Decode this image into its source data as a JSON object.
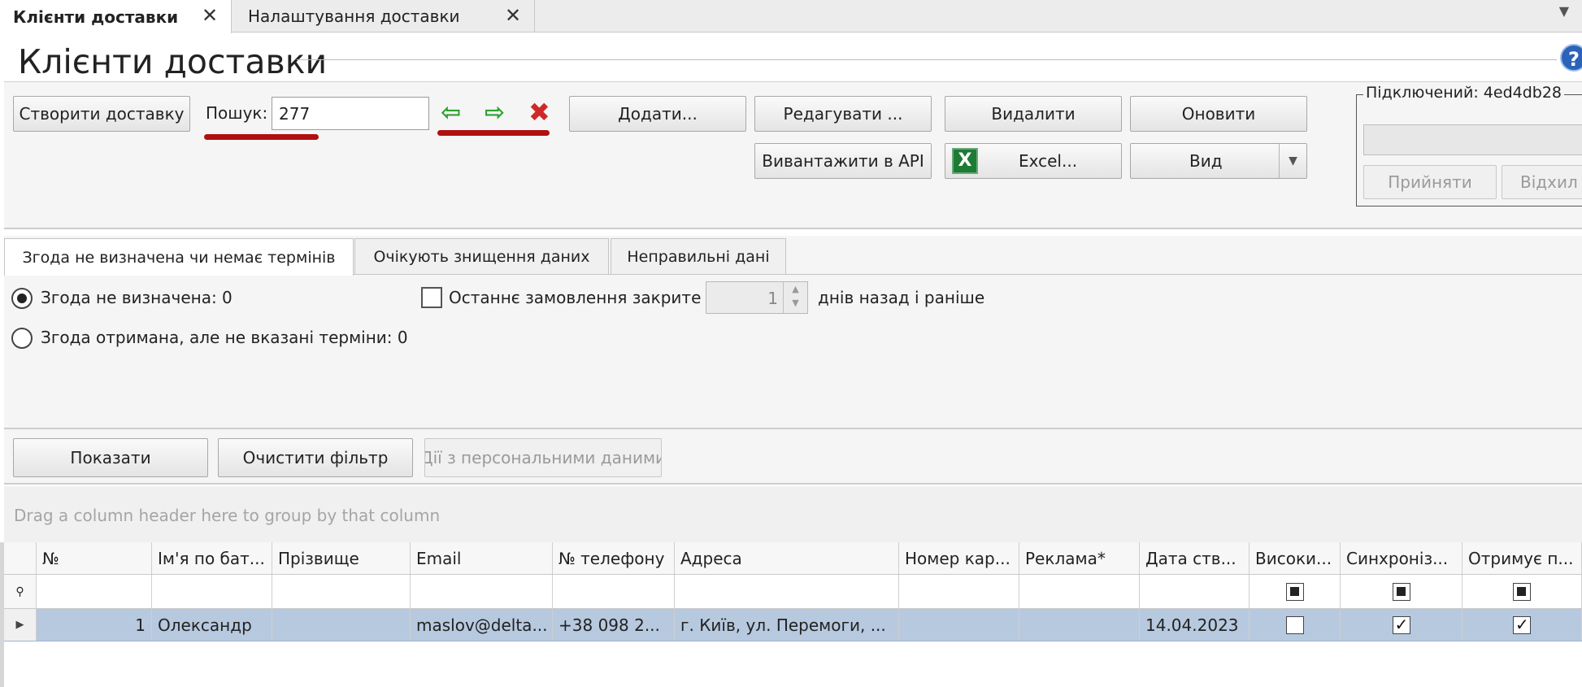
{
  "doc_tabs": [
    {
      "label": "Клієнти доставки",
      "active": true
    },
    {
      "label": "Налаштування доставки",
      "active": false
    }
  ],
  "title": "Клієнти доставки",
  "toolbar": {
    "create_delivery": "Створити доставку",
    "search_label": "Пошук:",
    "search_value": "277",
    "add": "Додати...",
    "edit": "Редагувати ...",
    "delete": "Видалити",
    "refresh": "Оновити",
    "upload_api": "Вивантажити в API",
    "excel": "Excel...",
    "view": "Вид"
  },
  "connection": {
    "label": "Підключений: 4ed4db28",
    "accept": "Прийняти",
    "reject": "Відхил"
  },
  "filter_tabs": [
    {
      "label": "Згода не визначена чи немає термінів",
      "active": true
    },
    {
      "label": "Очікують знищення даних",
      "active": false
    },
    {
      "label": "Неправильні дані",
      "active": false
    }
  ],
  "filters": {
    "radio_undefined": "Згода не визначена: 0",
    "radio_received": "Згода отримана, але не вказані терміни: 0",
    "last_order_label": "Останнє замовлення закрите",
    "days_value": "1",
    "days_suffix": "днів назад і раніше"
  },
  "actions": {
    "show": "Показати",
    "clear_filter": "Очистити фільтр",
    "personal_data": "Дії з персональними даними"
  },
  "grid": {
    "group_hint": "Drag a column header here to group by that column",
    "columns": [
      "№",
      "Ім'я по бат...",
      "Прізвище",
      "Email",
      "№ телефону",
      "Адреса",
      "Номер кар...",
      "Реклама*",
      "Дата ств...",
      "Високи...",
      "Синхроніз...",
      "Отримує п..."
    ],
    "rows": [
      {
        "num": "1",
        "name": "Олександр",
        "surname": "",
        "email": "maslov@delta...",
        "phone": "+38 098 2...",
        "address": "г. Київ, ул. Перемоги, ...",
        "card": "",
        "ads": "",
        "date": "14.04.2023",
        "high": false,
        "sync": true,
        "receives": true
      }
    ]
  }
}
